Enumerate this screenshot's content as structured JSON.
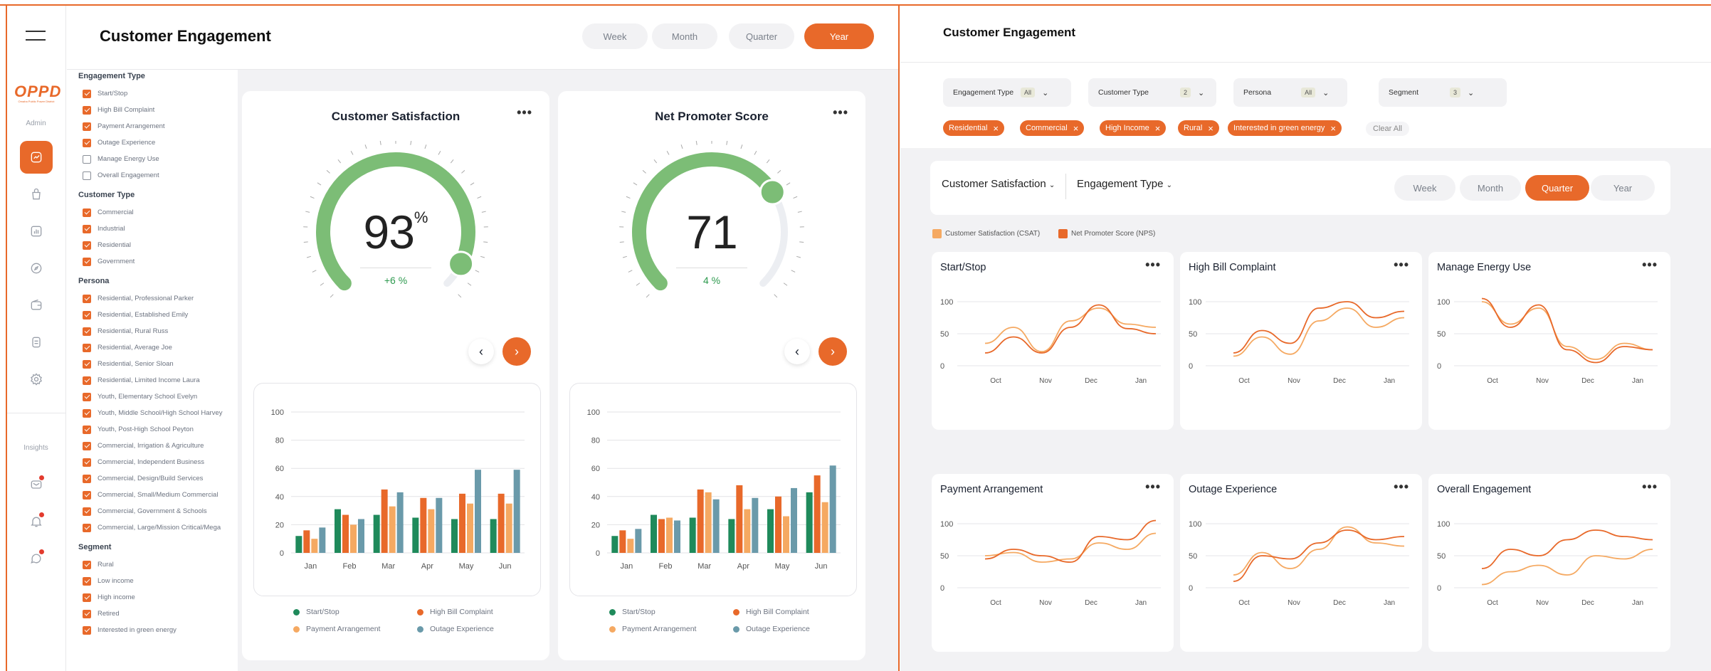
{
  "left": {
    "title": "Customer Engagement",
    "periods": [
      "Week",
      "Month",
      "Quarter",
      "Year"
    ],
    "active_period": "Year",
    "logo_text": "OPPD",
    "logo_sub": "Omaha Public Power District",
    "rail_role": "Admin",
    "rail_insights": "Insights",
    "filters": [
      {
        "title": "Engagement Type",
        "items": [
          {
            "label": "Start/Stop",
            "checked": true
          },
          {
            "label": "High Bill Complaint",
            "checked": true
          },
          {
            "label": "Payment Arrangement",
            "checked": true
          },
          {
            "label": "Outage Experience",
            "checked": true
          },
          {
            "label": "Manage Energy Use",
            "checked": false
          },
          {
            "label": "Overall Engagement",
            "checked": false
          }
        ]
      },
      {
        "title": "Customer Type",
        "items": [
          {
            "label": "Commercial",
            "checked": true
          },
          {
            "label": "Industrial",
            "checked": true
          },
          {
            "label": "Residential",
            "checked": true
          },
          {
            "label": "Government",
            "checked": true
          }
        ]
      },
      {
        "title": "Persona",
        "items": [
          {
            "label": "Residential,  Professional Parker",
            "checked": true
          },
          {
            "label": "Residential,  Established Emily",
            "checked": true
          },
          {
            "label": "Residential,  Rural Russ",
            "checked": true
          },
          {
            "label": "Residential,  Average Joe",
            "checked": true
          },
          {
            "label": "Residential,  Senior Sloan",
            "checked": true
          },
          {
            "label": "Residential,  Limited Income Laura",
            "checked": true
          },
          {
            "label": "Youth, Elementary School Evelyn",
            "checked": true
          },
          {
            "label": "Youth, Middle School/High School Harvey",
            "checked": true
          },
          {
            "label": "Youth, Post-High School Peyton",
            "checked": true
          },
          {
            "label": "Commercial, Irrigation & Agriculture",
            "checked": true
          },
          {
            "label": "Commercial, Independent Business",
            "checked": true
          },
          {
            "label": "Commercial, Design/Build Services",
            "checked": true
          },
          {
            "label": "Commercial, Small/Medium Commercial",
            "checked": true
          },
          {
            "label": "Commercial, Government & Schools",
            "checked": true
          },
          {
            "label": "Commercial, Large/Mission Critical/Mega",
            "checked": true
          }
        ]
      },
      {
        "title": "Segment",
        "items": [
          {
            "label": "Rural",
            "checked": true
          },
          {
            "label": "Low income",
            "checked": true
          },
          {
            "label": "High income",
            "checked": true
          },
          {
            "label": "Retired",
            "checked": true
          },
          {
            "label": "Interested in green energy",
            "checked": true
          }
        ]
      }
    ],
    "csat": {
      "title": "Customer Satisfaction",
      "value": "93",
      "unit": "%",
      "delta": "+6 %",
      "fraction": 0.93
    },
    "nps": {
      "title": "Net Promoter Score",
      "value": "71",
      "delta": "4 %",
      "fraction": 0.71
    },
    "more": "•••",
    "prev": "‹",
    "next": "›",
    "legend": [
      "Start/Stop",
      "High Bill Complaint",
      "Payment Arrangement",
      "Outage Experience"
    ]
  },
  "colors": {
    "orange": "#e8692a",
    "green": "#1f8a5b",
    "light_orange": "#f5a962",
    "teal": "#6a9aaa",
    "gauge": "#7cbd76"
  },
  "chart_data": [
    {
      "type": "bar",
      "id": "csat-bars",
      "categories": [
        "Jan",
        "Feb",
        "Mar",
        "Apr",
        "May",
        "Jun"
      ],
      "ylim": [
        0,
        100
      ],
      "yticks": [
        0,
        20,
        40,
        60,
        80,
        100
      ],
      "series": [
        {
          "name": "Start/Stop",
          "values": [
            12,
            31,
            27,
            25,
            24,
            24
          ]
        },
        {
          "name": "High Bill Complaint",
          "values": [
            16,
            27,
            45,
            39,
            42,
            42
          ]
        },
        {
          "name": "Payment Arrangement",
          "values": [
            10,
            20,
            33,
            31,
            35,
            35
          ]
        },
        {
          "name": "Outage Experience",
          "values": [
            18,
            24,
            43,
            39,
            59,
            59
          ]
        }
      ]
    },
    {
      "type": "bar",
      "id": "nps-bars",
      "categories": [
        "Jan",
        "Feb",
        "Mar",
        "Apr",
        "May",
        "Jun"
      ],
      "ylim": [
        0,
        100
      ],
      "yticks": [
        0,
        20,
        40,
        60,
        80,
        100
      ],
      "series": [
        {
          "name": "Start/Stop",
          "values": [
            12,
            27,
            25,
            24,
            31,
            43
          ]
        },
        {
          "name": "High Bill Complaint",
          "values": [
            16,
            24,
            45,
            48,
            40,
            55
          ]
        },
        {
          "name": "Payment Arrangement",
          "values": [
            10,
            25,
            43,
            31,
            26,
            36
          ]
        },
        {
          "name": "Outage Experience",
          "values": [
            17,
            23,
            38,
            39,
            46,
            62
          ]
        }
      ]
    },
    {
      "type": "line",
      "id": "start-stop",
      "title": "Start/Stop",
      "x": [
        "Oct",
        "Nov",
        "Dec",
        "Jan"
      ],
      "ylim": [
        0,
        100
      ],
      "yticks": [
        0,
        50,
        100
      ],
      "series": [
        {
          "name": "Customer Satisfaction (CSAT)",
          "values": [
            35,
            60,
            22,
            70,
            90,
            65,
            60
          ]
        },
        {
          "name": "Net Promoter Score (NPS)",
          "values": [
            20,
            45,
            20,
            60,
            95,
            58,
            50
          ]
        }
      ]
    },
    {
      "type": "line",
      "id": "high-bill",
      "title": "High Bill Complaint",
      "x": [
        "Oct",
        "Nov",
        "Dec",
        "Jan"
      ],
      "ylim": [
        0,
        100
      ],
      "yticks": [
        0,
        50,
        100
      ],
      "series": [
        {
          "name": "Customer Satisfaction (CSAT)",
          "values": [
            15,
            45,
            18,
            70,
            90,
            60,
            75
          ]
        },
        {
          "name": "Net Promoter Score (NPS)",
          "values": [
            20,
            55,
            35,
            90,
            100,
            75,
            85
          ]
        }
      ]
    },
    {
      "type": "line",
      "id": "manage-energy",
      "title": "Manage Energy Use",
      "x": [
        "Oct",
        "Nov",
        "Dec",
        "Jan"
      ],
      "ylim": [
        0,
        100
      ],
      "yticks": [
        0,
        50,
        100
      ],
      "series": [
        {
          "name": "Customer Satisfaction (CSAT)",
          "values": [
            100,
            65,
            90,
            30,
            10,
            35,
            25
          ]
        },
        {
          "name": "Net Promoter Score (NPS)",
          "values": [
            105,
            60,
            95,
            25,
            5,
            30,
            25
          ]
        }
      ]
    },
    {
      "type": "line",
      "id": "payment",
      "title": "Payment Arrangement",
      "x": [
        "Oct",
        "Nov",
        "Dec",
        "Jan"
      ],
      "ylim": [
        0,
        100
      ],
      "yticks": [
        0,
        50,
        100
      ],
      "series": [
        {
          "name": "Customer Satisfaction (CSAT)",
          "values": [
            50,
            55,
            40,
            45,
            70,
            60,
            85
          ]
        },
        {
          "name": "Net Promoter Score (NPS)",
          "values": [
            45,
            60,
            50,
            40,
            80,
            75,
            105
          ]
        }
      ]
    },
    {
      "type": "line",
      "id": "outage",
      "title": "Outage Experience",
      "x": [
        "Oct",
        "Nov",
        "Dec",
        "Jan"
      ],
      "ylim": [
        0,
        100
      ],
      "yticks": [
        0,
        50,
        100
      ],
      "series": [
        {
          "name": "Customer Satisfaction (CSAT)",
          "values": [
            20,
            55,
            30,
            60,
            95,
            70,
            65
          ]
        },
        {
          "name": "Net Promoter Score (NPS)",
          "values": [
            10,
            50,
            45,
            70,
            90,
            75,
            80
          ]
        }
      ]
    },
    {
      "type": "line",
      "id": "overall",
      "title": "Overall Engagement",
      "x": [
        "Oct",
        "Nov",
        "Dec",
        "Jan"
      ],
      "ylim": [
        0,
        100
      ],
      "yticks": [
        0,
        50,
        100
      ],
      "series": [
        {
          "name": "Customer Satisfaction (CSAT)",
          "values": [
            5,
            25,
            35,
            20,
            50,
            45,
            60
          ]
        },
        {
          "name": "Net Promoter Score (NPS)",
          "values": [
            30,
            60,
            50,
            75,
            90,
            80,
            75
          ]
        }
      ]
    }
  ],
  "right": {
    "title": "Customer Engagement",
    "dropdowns": [
      {
        "label": "Engagement Type",
        "badge": "All"
      },
      {
        "label": "Customer Type",
        "badge": "2"
      },
      {
        "label": "Persona",
        "badge": "All"
      },
      {
        "label": "Segment",
        "badge": "3"
      }
    ],
    "chips": [
      "Residential",
      "Commercial",
      "High Income",
      "Rural",
      "Interested in green energy"
    ],
    "clear_all": "Clear All",
    "metric_select": "Customer Satisfaction",
    "type_select": "Engagement Type",
    "periods": [
      "Week",
      "Month",
      "Quarter",
      "Year"
    ],
    "active_period": "Quarter",
    "legend": [
      "Customer Satisfaction (CSAT)",
      "Net Promoter Score (NPS)"
    ]
  }
}
